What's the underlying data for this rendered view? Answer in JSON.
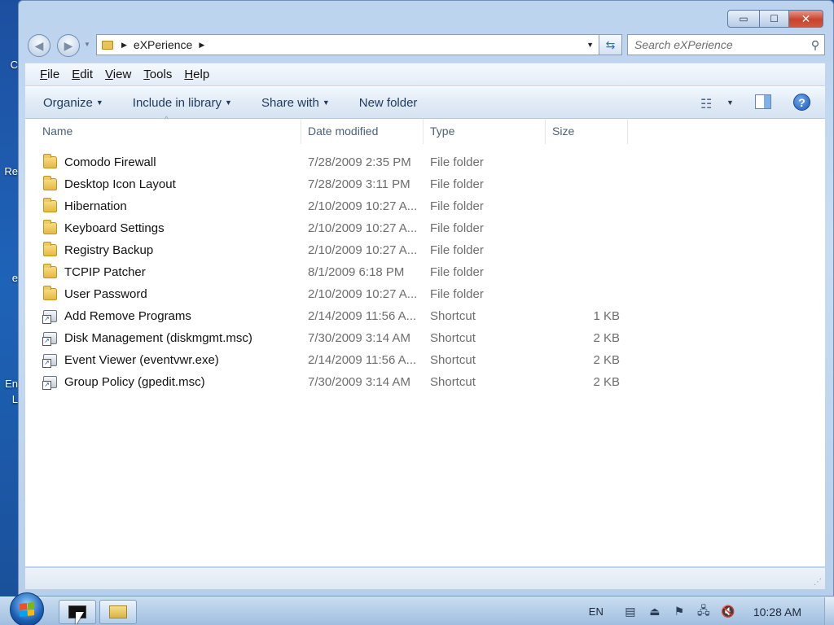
{
  "desktop_fragments": [
    "C",
    "Re",
    "e",
    "En",
    "L"
  ],
  "window": {
    "caption_buttons": {
      "minimize": "▭",
      "maximize": "☐",
      "close": "✕"
    },
    "nav": {
      "back": "◀",
      "forward": "▶"
    },
    "address": {
      "path": "eXPerience"
    },
    "search": {
      "placeholder": "Search eXPerience"
    },
    "menu": [
      {
        "underline": "F",
        "rest": "ile"
      },
      {
        "underline": "E",
        "rest": "dit"
      },
      {
        "underline": "V",
        "rest": "iew"
      },
      {
        "underline": "T",
        "rest": "ools"
      },
      {
        "underline": "H",
        "rest": "elp"
      }
    ],
    "commands": {
      "organize": "Organize",
      "include_in_library": "Include in library",
      "share_with": "Share with",
      "new_folder": "New folder"
    },
    "columns": {
      "name": "Name",
      "date": "Date modified",
      "type": "Type",
      "size": "Size"
    },
    "files": [
      {
        "name": "Comodo Firewall",
        "date": "7/28/2009 2:35 PM",
        "type": "File folder",
        "size": "",
        "icon": "folder-icon"
      },
      {
        "name": "Desktop Icon Layout",
        "date": "7/28/2009 3:11 PM",
        "type": "File folder",
        "size": "",
        "icon": "folder-icon"
      },
      {
        "name": "Hibernation",
        "date": "2/10/2009 10:27 A...",
        "type": "File folder",
        "size": "",
        "icon": "folder-icon"
      },
      {
        "name": "Keyboard Settings",
        "date": "2/10/2009 10:27 A...",
        "type": "File folder",
        "size": "",
        "icon": "folder-icon"
      },
      {
        "name": "Registry Backup",
        "date": "2/10/2009 10:27 A...",
        "type": "File folder",
        "size": "",
        "icon": "folder-icon"
      },
      {
        "name": "TCPIP Patcher",
        "date": "8/1/2009 6:18 PM",
        "type": "File folder",
        "size": "",
        "icon": "folder-icon"
      },
      {
        "name": "User Password",
        "date": "2/10/2009 10:27 A...",
        "type": "File folder",
        "size": "",
        "icon": "folder-icon"
      },
      {
        "name": "Add Remove Programs",
        "date": "2/14/2009 11:56 A...",
        "type": "Shortcut",
        "size": "1 KB",
        "icon": "shortcut-icon"
      },
      {
        "name": "Disk Management (diskmgmt.msc)",
        "date": "7/30/2009 3:14 AM",
        "type": "Shortcut",
        "size": "2 KB",
        "icon": "shortcut-icon"
      },
      {
        "name": "Event Viewer (eventvwr.exe)",
        "date": "2/14/2009 11:56 A...",
        "type": "Shortcut",
        "size": "2 KB",
        "icon": "shortcut-icon"
      },
      {
        "name": "Group Policy (gpedit.msc)",
        "date": "7/30/2009 3:14 AM",
        "type": "Shortcut",
        "size": "2 KB",
        "icon": "shortcut-icon"
      }
    ]
  },
  "taskbar": {
    "language": "EN",
    "clock": "10:28 AM"
  },
  "colors": {
    "accent": "#1e3a5c",
    "close_button": "#c8432c",
    "desktop": "#1e63b8"
  }
}
